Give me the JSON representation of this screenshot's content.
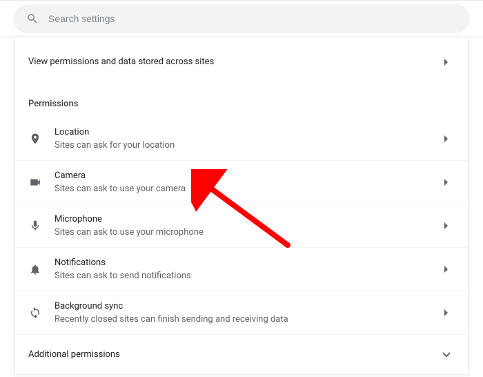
{
  "search": {
    "placeholder": "Search settings"
  },
  "top_row": {
    "label": "View permissions and data stored across sites"
  },
  "section_title": "Permissions",
  "permissions": [
    {
      "title": "Location",
      "sub": "Sites can ask for your location"
    },
    {
      "title": "Camera",
      "sub": "Sites can ask to use your camera"
    },
    {
      "title": "Microphone",
      "sub": "Sites can ask to use your microphone"
    },
    {
      "title": "Notifications",
      "sub": "Sites can ask to send notifications"
    },
    {
      "title": "Background sync",
      "sub": "Recently closed sites can finish sending and receiving data"
    }
  ],
  "additional": {
    "label": "Additional permissions"
  },
  "annotations": [
    {
      "type": "arrow",
      "target": "permission-camera"
    }
  ]
}
